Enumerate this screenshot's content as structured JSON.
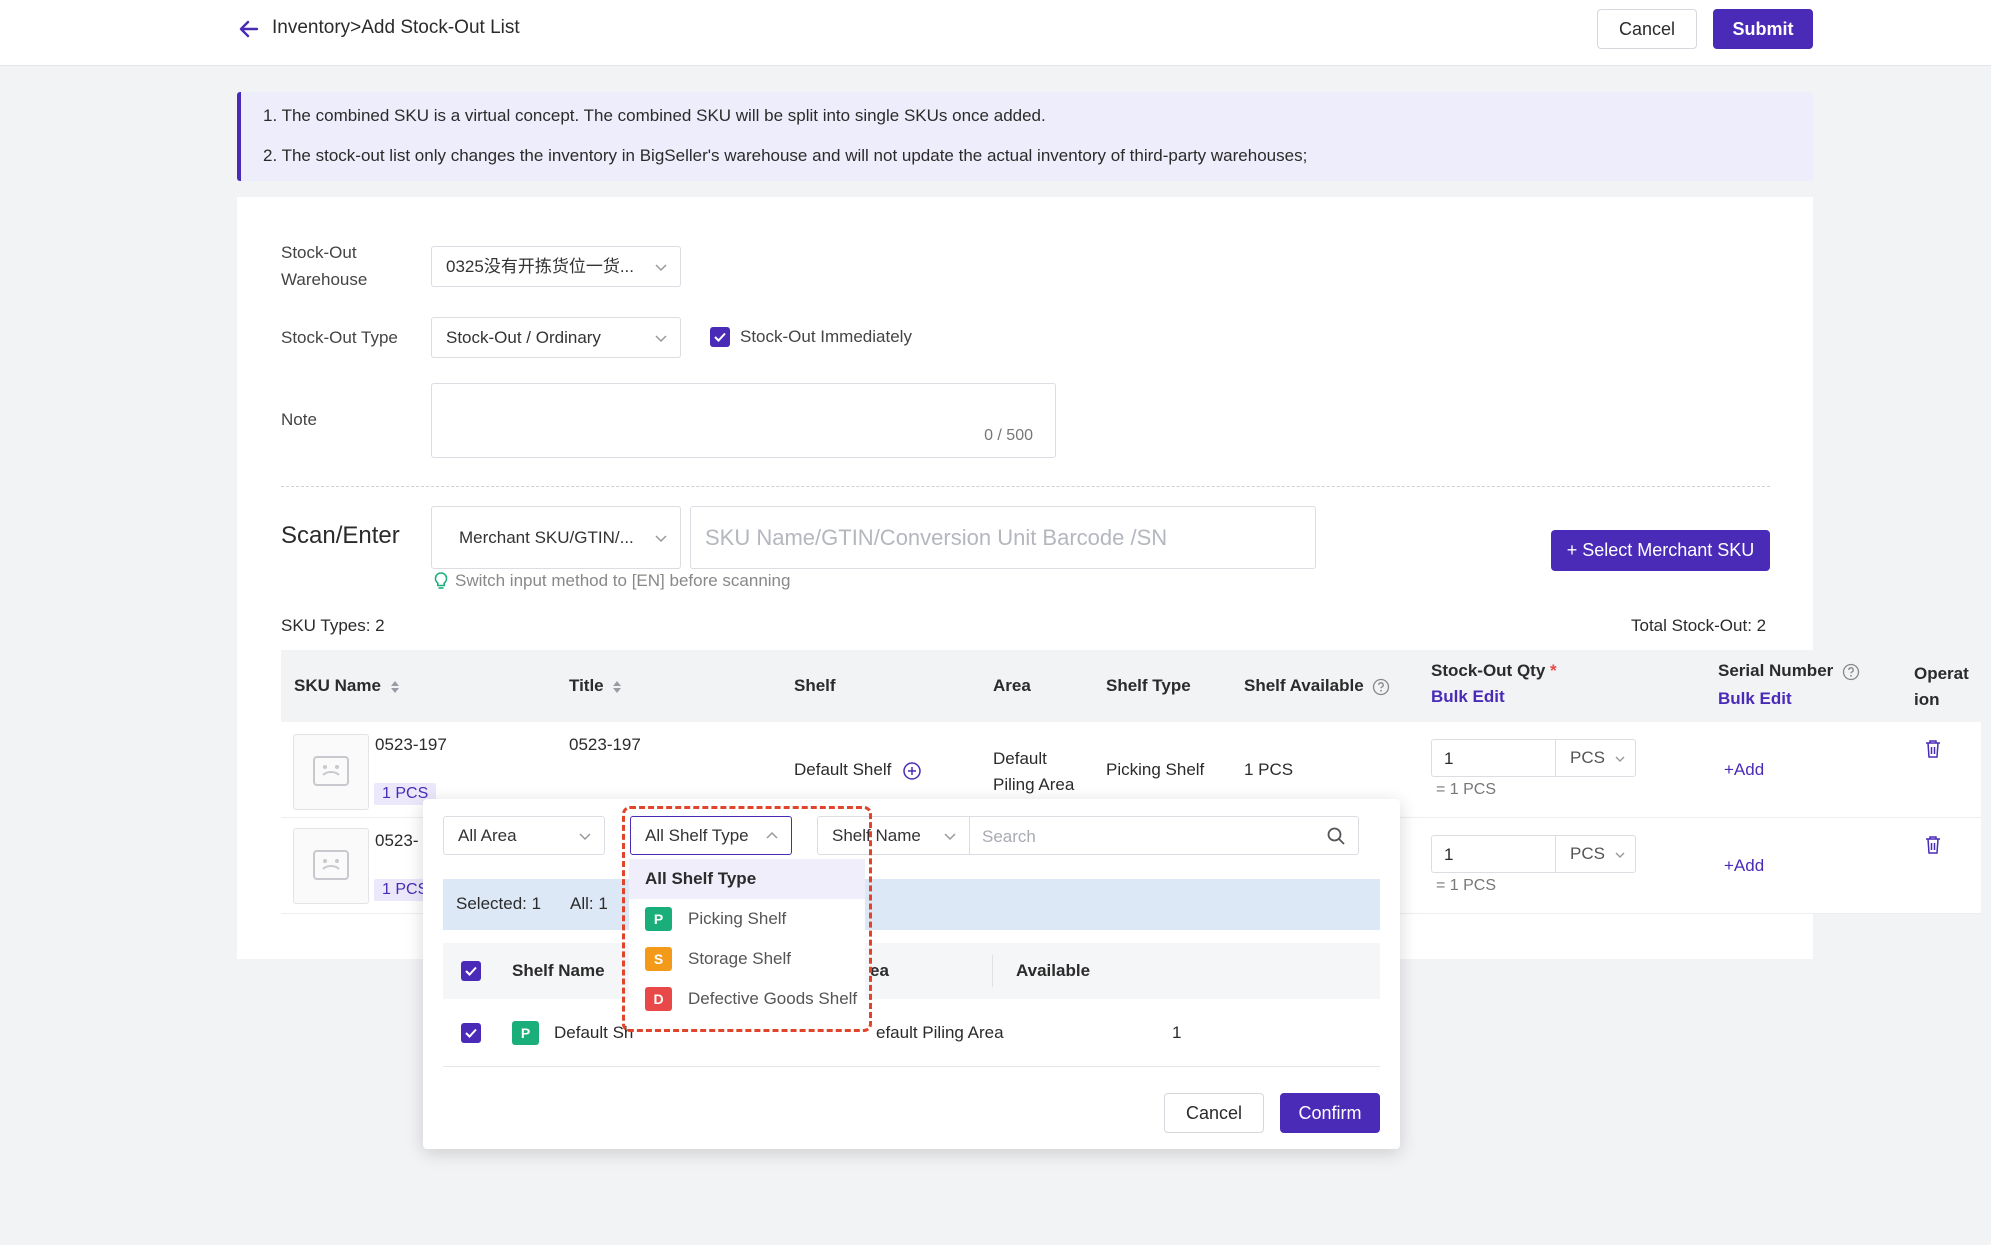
{
  "header": {
    "title": "Inventory>Add Stock-Out List",
    "cancel_label": "Cancel",
    "submit_label": "Submit"
  },
  "notice": {
    "line1": "1. The combined SKU is a virtual concept. The combined SKU will be split into single SKUs once added.",
    "line2": "2. The stock-out list only changes the inventory in BigSeller's warehouse and will not update the actual inventory of third-party warehouses;"
  },
  "form": {
    "warehouse_label_1": "Stock-Out",
    "warehouse_label_2": "Warehouse",
    "warehouse_value": "0325没有开拣货位一货...",
    "type_label": "Stock-Out Type",
    "type_value": "Stock-Out / Ordinary",
    "immediate_label": "Stock-Out Immediately",
    "immediate_checked": true,
    "note_label": "Note",
    "note_counter": "0 / 500"
  },
  "scan": {
    "title": "Scan/Enter",
    "mode_value": "Merchant SKU/GTIN/...",
    "input_placeholder": "SKU Name/GTIN/Conversion Unit Barcode /SN",
    "hint": "Switch input method to [EN] before scanning",
    "select_button": "+ Select Merchant SKU"
  },
  "summary": {
    "sku_types": "SKU Types: 2",
    "total": "Total Stock-Out: 2"
  },
  "table": {
    "headers": {
      "sku_name": "SKU Name",
      "title": "Title",
      "shelf": "Shelf",
      "area": "Area",
      "shelf_type": "Shelf Type",
      "shelf_available": "Shelf Available",
      "qty": "Stock-Out Qty",
      "qty_required": "*",
      "bulk_edit": "Bulk Edit",
      "serial": "Serial Number",
      "serial_bulk_edit": "Bulk Edit",
      "operation_1": "Operat",
      "operation_2": "ion"
    },
    "rows": [
      {
        "sku": "0523-197",
        "pcs_tag": "1 PCS",
        "title": "0523-197",
        "shelf": "Default Shelf",
        "area_1": "Default",
        "area_2": "Piling Area",
        "shelf_type": "Picking Shelf",
        "available": "1 PCS",
        "qty": "1",
        "unit": "PCS",
        "equiv": "= 1 PCS",
        "add": "+Add"
      },
      {
        "sku": "0523-",
        "pcs_tag": "1 PCS",
        "qty": "1",
        "unit": "PCS",
        "equiv": "= 1 PCS",
        "add": "+Add"
      }
    ]
  },
  "popover": {
    "area_filter": "All Area",
    "shelf_type_filter": "All Shelf Type",
    "shelf_name_filter": "Shelf Name",
    "search_placeholder": "Search",
    "selected": "Selected: 1",
    "all": "All: 1",
    "col_shelf_name": "Shelf Name",
    "col_area": "ea",
    "col_available": "Available",
    "row": {
      "badge": "P",
      "name": "Default Sh",
      "area": "efault Piling Area",
      "available": "1"
    },
    "cancel_label": "Cancel",
    "confirm_label": "Confirm"
  },
  "shelf_type_dropdown": {
    "items": [
      {
        "label": "All Shelf Type",
        "badge": "",
        "color": ""
      },
      {
        "label": "Picking Shelf",
        "badge": "P",
        "color": "#1aaf7a"
      },
      {
        "label": "Storage Shelf",
        "badge": "S",
        "color": "#f39a1a"
      },
      {
        "label": "Defective Goods Shelf",
        "badge": "D",
        "color": "#e94848"
      }
    ]
  },
  "colors": {
    "primary": "#4a2bb8",
    "highlight": "#e0452b",
    "notice_bg": "#eeedfb"
  }
}
